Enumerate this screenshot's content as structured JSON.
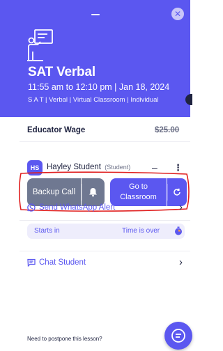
{
  "header": {
    "close_glyph": "✕",
    "title": "SAT Verbal",
    "time": "11:55 am to 12:10 pm | Jan 18, 2024",
    "tags": "S A T | Verbal | Virtual Classroom | Individual"
  },
  "wage": {
    "label": "Educator Wage",
    "amount": "$25.00"
  },
  "student": {
    "initials": "HS",
    "name": "Hayley Student",
    "role": "(Student)",
    "collapse_glyph": "–",
    "more_glyph": "⋮"
  },
  "actions": {
    "backup_call": "Backup Call",
    "go_to_classroom_line1": "Go to",
    "go_to_classroom_line2": "Classroom"
  },
  "status": {
    "starts_in": "Starts in",
    "time_over": "Time is over"
  },
  "links": {
    "whatsapp": "Send WhatsApp Alert",
    "chat": "Chat Student",
    "chevron": "›"
  },
  "footer": {
    "postpone": "Need to postpone this lesson?"
  },
  "colors": {
    "brand": "#5b57f0",
    "secondary_button": "#6f7891",
    "annotation": "#e02020"
  },
  "icons": [
    "classroom-icon",
    "close-icon",
    "bell-icon",
    "refresh-icon",
    "timer-icon",
    "whatsapp-icon",
    "chat-icon",
    "chat-fab-icon"
  ]
}
